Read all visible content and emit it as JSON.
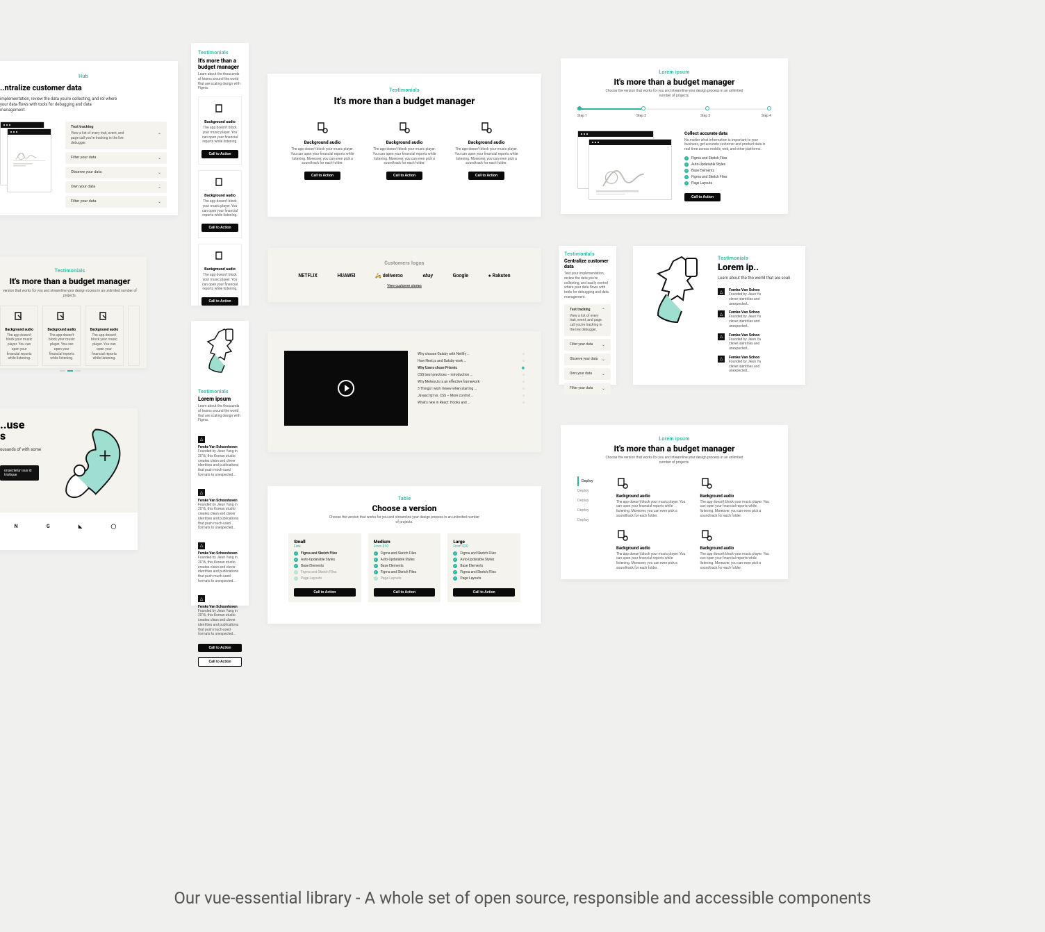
{
  "common": {
    "testimonials": "Testimonials",
    "lorem_ipsum_eyebrow": "Lorem ipsum",
    "budget_heading": "It's more than a budget manager",
    "version_sub": "Choose the version that works for you and streamline your design process in an unlimited number of projects.",
    "cta": "Call to Action",
    "bg_audio": "Background audio",
    "bg_audio_desc_full": "The app doesn't block your music player. You can open your financial reports while listening. Moreover, you can even pick a soundtrack for each folder.",
    "bg_audio_desc_short": "The app doesn't block your music player. You can open your financial reports while listening.",
    "figma_desc": "Learn about the thousands of teams around the world that are scaling design with Figma."
  },
  "card_a": {
    "eyebrow": "Hub",
    "title": "..ntralize customer data",
    "desc": "implementation, review the data you're collecting, and rol where your data flows with tools for debugging and data management.",
    "row1": {
      "label": "Test tracking",
      "sub": "View a list of every trait, event, and page call you're tracking in the live debugger."
    },
    "rows": [
      "Filter your data",
      "Observe your data",
      "Own your data",
      "Filter your data"
    ]
  },
  "card_b": {
    "sub": "version that works for you and streamline your design rocess in an unlimited number of projects.",
    "card_desc": "The app doesn't block your music player. You can open your financial reports while listening."
  },
  "card_c": {
    "title_a": "..use",
    "title_b": "s",
    "desc": "ousands of with some",
    "tooltip": "onsectetur isus id tristique"
  },
  "card_d_logos": [
    "N",
    "G",
    "◣",
    "◯"
  ],
  "card_f": {
    "title": "Lorem ipsum",
    "name": "Femke Van Schoonhoven",
    "bio": "Founded by Jieun Yang in 2016, this Korean studio creates clean and clever identities and publications that push much-used formats to unexpected…"
  },
  "card_h": {
    "label": "Customers logos",
    "more": "View customer stories",
    "logos": [
      "NETFLIX",
      "HUAWEI",
      "deliveroo",
      "ebay",
      "Google",
      "Rakuten"
    ]
  },
  "card_i": {
    "list": [
      "Why choose Gatsby with Netlify …",
      "How Next.js and Gatsby work …",
      "Why Users chose Prismic",
      "CSS best practices – introduction …",
      "Why MeteorJs is an effective framework",
      "3 Things I wish I knew when starting …",
      "Javascript vs. CSS – More control …",
      "What's new in React: Hooks and …"
    ]
  },
  "card_j": {
    "eyebrow": "Table",
    "title": "Choose a version",
    "plans": [
      {
        "name": "Small",
        "price": "Free"
      },
      {
        "name": "Medium",
        "price": "From $10"
      },
      {
        "name": "Large",
        "price": "From $20"
      }
    ],
    "features": [
      "Figma and Sketch Files",
      "Auto-Updatable Styles",
      "Base Elements",
      "Figma and Sketch Files",
      "Page Layouts"
    ]
  },
  "card_k": {
    "steps": [
      "Step 1",
      "Step 2",
      "Step 3",
      "Step 4"
    ],
    "right_title": "Collect accurate data",
    "right_desc": "No matter what information is important to your business, get accurate customer and product data in real time across mobile, web, and other platforms.",
    "bullets": [
      "Figma and Sketch Files",
      "Auto-Updatable Styles",
      "Base Elements",
      "Figma and Sketch Files",
      "Page Layouts"
    ]
  },
  "card_l": {
    "title": "Centralize customer data",
    "desc": "Test your implementation, review the data you're collecting, and easily control where your data flows with tools for debugging and data management.",
    "row1": {
      "label": "Test tracking",
      "sub": "View a list of every trait, event, and page call you're tracking in the live debugger."
    },
    "rows": [
      "Filter your data",
      "Observe your data",
      "Own your data",
      "Filter your data"
    ]
  },
  "card_m": {
    "title": "Lorem ip..",
    "sub": "Learn about the tho world that are scali",
    "name": "Femke Van Schoo",
    "bio1": "Founded by Jieun Ya",
    "bio2": "clever identities and",
    "bio3": "unexpected…"
  },
  "card_n": {
    "sidebar": [
      "Deploy",
      "Deploy",
      "Deploy",
      "Deploy",
      "Deploy"
    ]
  },
  "caption": "Our vue-essential library - A whole set of open source, responsible and accessible components"
}
